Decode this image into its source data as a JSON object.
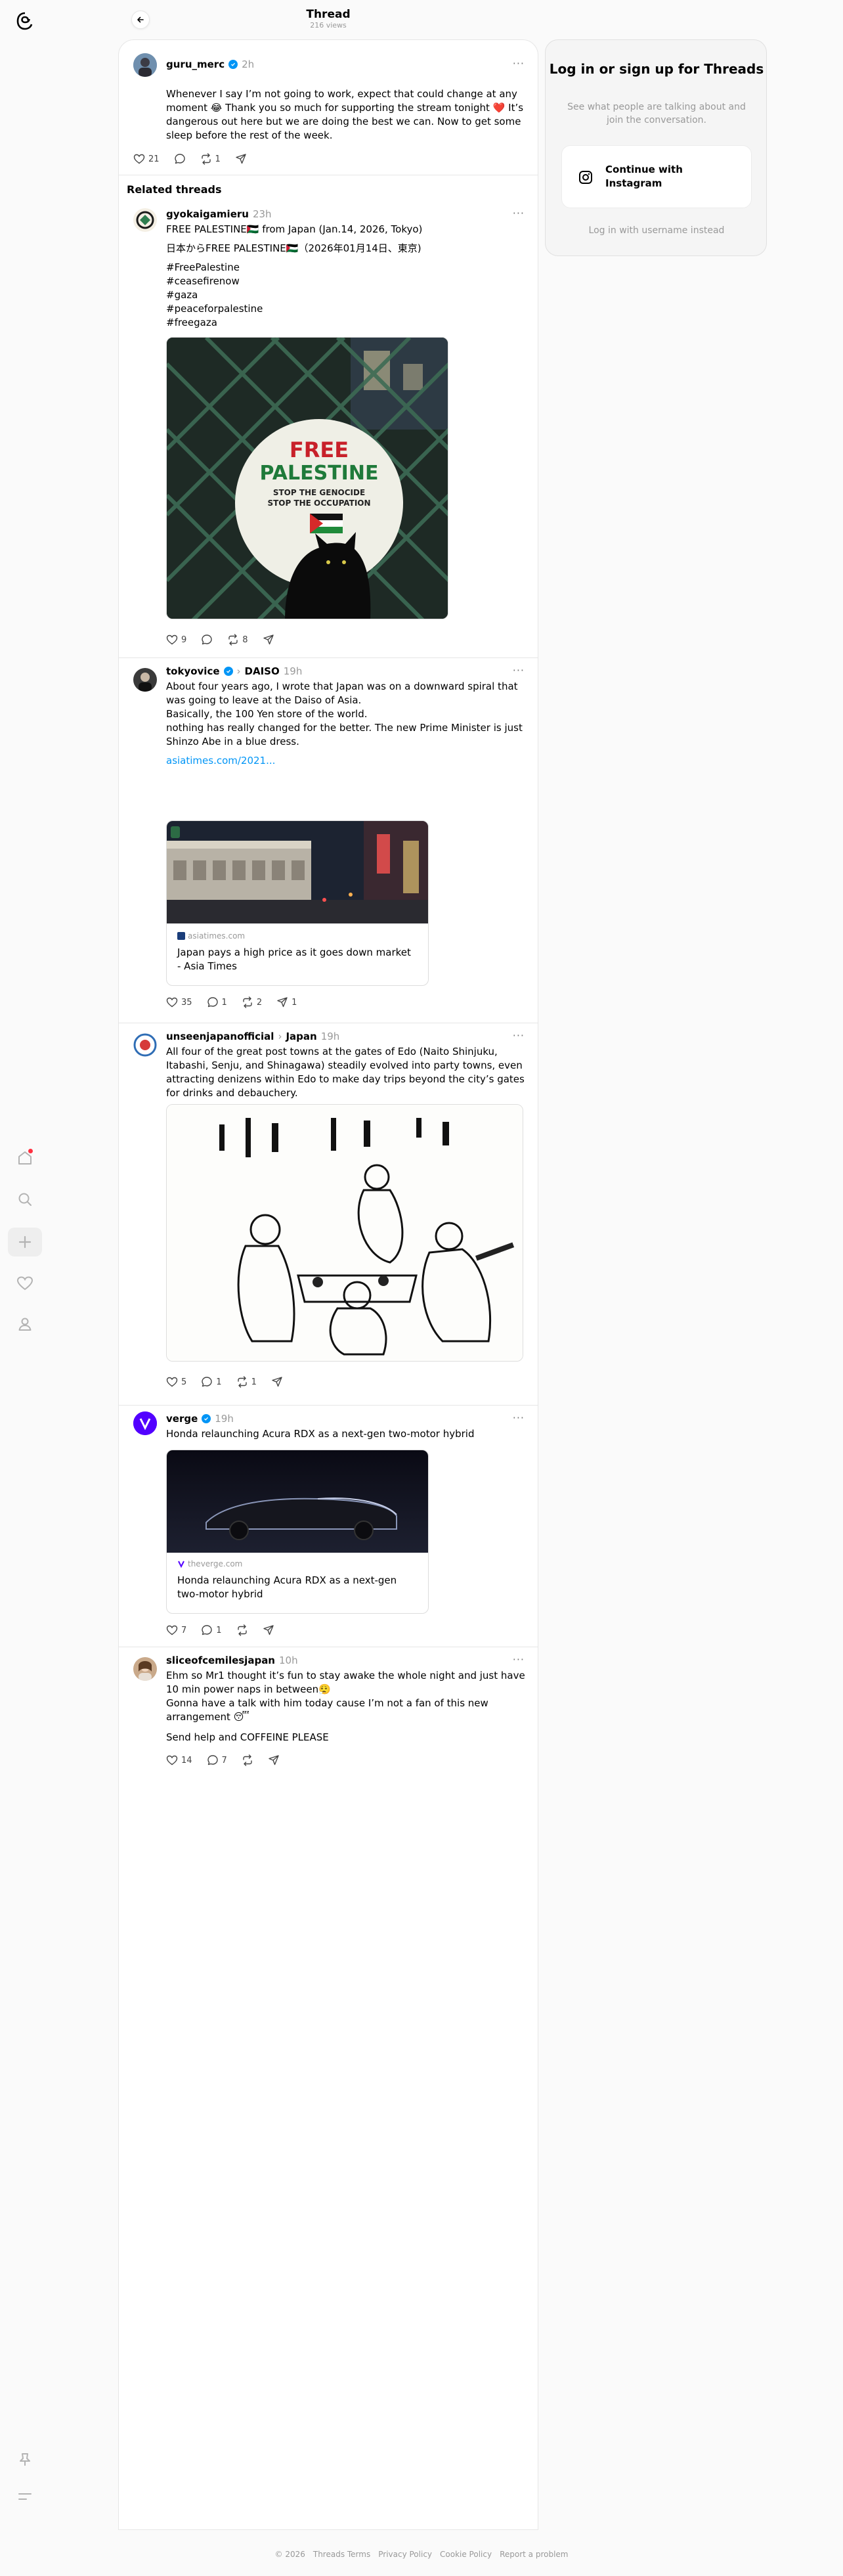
{
  "header": {
    "title": "Thread",
    "subtitle": "216 views"
  },
  "main_post": {
    "author": "guru_merc",
    "time": "2h",
    "text": "Whenever I say I’m not going to work, expect that could change at any moment 😂 Thank you so much for supporting the stream tonight ❤️ It’s dangerous out here but we are doing the best we can. Now to get some sleep before the rest of the week.",
    "likes": "21",
    "reposts": "1"
  },
  "related_heading": "Related threads",
  "posts": [
    {
      "author": "gyokaigamieru",
      "time": "23h",
      "lines": [
        "FREE PALESTINE🇵🇸 from Japan (Jan.14, 2026, Tokyo)",
        "日本からFREE PALESTINE🇵🇸（2026年01月14日、東京)",
        "#FreePalestine",
        "#ceasefirenow",
        "#gaza",
        "#peaceforpalestine",
        "#freegaza"
      ],
      "image": {
        "line1": "FREE",
        "line2": "PALESTINE",
        "line3": "STOP THE GENOCIDE",
        "line4": "STOP THE OCCUPATION"
      },
      "likes": "9",
      "reposts": "8"
    },
    {
      "author": "tokyovice",
      "community": "DAISO",
      "time": "19h",
      "lines": [
        "About four years ago, I wrote that Japan was on a downward spiral that was going to leave at the Daiso of Asia.",
        "Basically, the 100 Yen store of the world.",
        "nothing has really changed for the better.  The new Prime Minister is just Shinzo Abe in a blue dress."
      ],
      "link_text": "asiatimes.com/2021...",
      "card": {
        "domain": "asiatimes.com",
        "title": "Japan pays a high price as it goes down market - Asia Times"
      },
      "likes": "35",
      "replies": "1",
      "reposts": "2",
      "shares": "1"
    },
    {
      "author": "unseenjapanofficial",
      "community": "Japan",
      "time": "19h",
      "text": "All four of the great post towns at the gates of Edo (Naito Shinjuku, Itabashi, Senju, and Shinagawa) steadily evolved into party towns, even attracting denizens within Edo to make day trips beyond the city’s gates for drinks and debauchery.",
      "likes": "5",
      "replies": "1",
      "reposts": "1"
    },
    {
      "author": "verge",
      "time": "19h",
      "text": "Honda relaunching Acura RDX as a next-gen two-motor hybrid",
      "card": {
        "domain": "theverge.com",
        "title": "Honda relaunching Acura RDX as a next-gen two-motor hybrid"
      },
      "likes": "7",
      "replies": "1"
    },
    {
      "author": "sliceofcemilesjapan",
      "time": "10h",
      "text": "Ehm so Mr1 thought it’s fun to stay awake the whole night and just have 10 min power naps in between😮‍💨\nGonna have a talk with him today cause I’m not a fan of this new arrangement 😴",
      "text2": "Send help and COFFEINE PLEASE",
      "likes": "14",
      "replies": "7"
    }
  ],
  "login_card": {
    "title": "Log in or sign up for Threads",
    "subtitle": "See what people are talking about and join the conversation.",
    "button": "Continue with Instagram",
    "alt": "Log in with username instead"
  },
  "footer": [
    "© 2026",
    "Threads Terms",
    "Privacy Policy",
    "Cookie Policy",
    "Report a problem"
  ],
  "colors": {
    "accent": "#0095f6",
    "notification": "#ff3040",
    "verge_brand": "#5200ff"
  }
}
